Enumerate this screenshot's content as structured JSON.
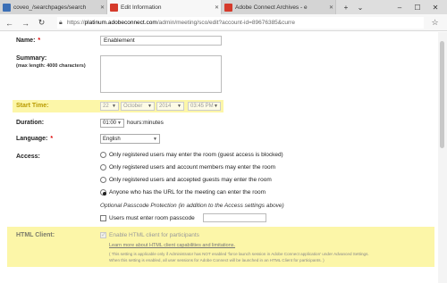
{
  "browser": {
    "tabs": [
      {
        "label": "coveo_/searchpages/search",
        "active": false
      },
      {
        "label": "Edit Information",
        "active": true
      },
      {
        "label": "Adobe Connect Archives - e",
        "active": false
      }
    ],
    "url_prefix": "https://",
    "url_host": "platinum.adobeconnect.com",
    "url_path": "/admin/meeting/sco/edit?account-id=89676385&curre"
  },
  "form": {
    "name": {
      "label": "Name:",
      "required": "*",
      "value": "Enablement"
    },
    "summary": {
      "label": "Summary:",
      "hint": "(max length: 4000 characters)",
      "value": ""
    },
    "start_time": {
      "label": "Start Time:",
      "day": "22",
      "month": "October",
      "year": "2014",
      "time": "03:45 PM"
    },
    "duration": {
      "label": "Duration:",
      "value": "01:00",
      "unit": "hours:minutes"
    },
    "language": {
      "label": "Language:",
      "required": "*",
      "value": "English"
    },
    "access": {
      "label": "Access:",
      "options": [
        "Only registered users may enter the room (guest access is blocked)",
        "Only registered users and account members may enter the room",
        "Only registered users and accepted guests may enter the room",
        "Anyone who has the URL for the meeting can enter the room"
      ],
      "selected_index": 3,
      "passcode_note": "Optional Passcode Protection (in addition to the Access settings above)",
      "passcode_checkbox": "Users must enter room passcode",
      "passcode_value": ""
    },
    "html_client": {
      "label": "HTML Client:",
      "checkbox": "Enable HTML client for participants",
      "link": "Learn more about HTML client capabilities and limitations.",
      "note_line1": "( This setting is applicable only if Administrator has NOT enabled 'force launch session in Adobe Connect application' under Advanced Settings.",
      "note_line2": "When this setting is enabled, all user sessions for Adobe Connect will be launched in an HTML Client for participants. )"
    }
  },
  "colors": {
    "highlight": "#fcf6a8",
    "required": "#dd0000",
    "link": "#555555"
  }
}
